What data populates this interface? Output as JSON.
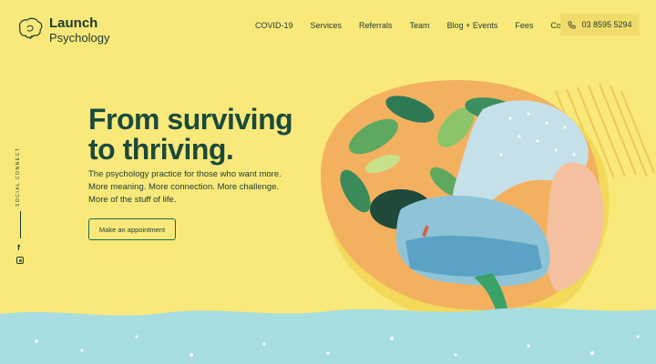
{
  "brand": {
    "name": "Launch",
    "subname": "Psychology"
  },
  "nav": {
    "items": [
      "COVID-19",
      "Services",
      "Referrals",
      "Team",
      "Blog + Events",
      "Fees",
      "Contact"
    ],
    "phone": "03 8595 5294"
  },
  "social": {
    "label": "SOCIAL CONNECT",
    "facebook_glyph": "f"
  },
  "hero": {
    "title_line1": "From surviving",
    "title_line2": "to thriving.",
    "sub_lines": [
      "The psychology practice for those who want more.",
      "More meaning. More connection. More challenge.",
      "More of the stuff of life."
    ],
    "cta": "Make an appointment"
  },
  "colors": {
    "background": "#f8e97a",
    "heading": "#1b4a3c",
    "accent_green": "#1f6b50",
    "water": "#a8dde1"
  }
}
